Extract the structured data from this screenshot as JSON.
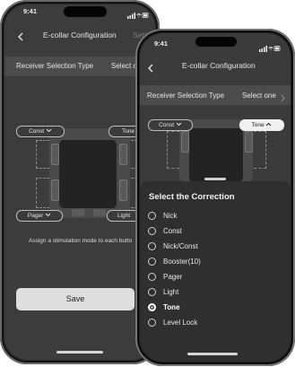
{
  "back_screen": {
    "status_time": "9:41",
    "nav_title": "E-collar Configuration",
    "nav_right": "Setti",
    "receiver_row": {
      "label": "Receiver Selection Type",
      "value": "Select o"
    },
    "chips": {
      "top_left": "Const",
      "top_right": "Tone",
      "bottom_left": "Pager",
      "bottom_right": "Light"
    },
    "help_text": "Assign a stimulation mode to each butto",
    "save_label": "Save"
  },
  "front_screen": {
    "status_time": "9:41",
    "back_icon": "chevron-left-icon",
    "nav_title": "E-collar Configuration",
    "receiver_row": {
      "label": "Receiver Selection Type",
      "value": "Select one"
    },
    "chips": {
      "left": "Const",
      "right": "Tone"
    },
    "sheet": {
      "title": "Select the Correction",
      "options": [
        {
          "label": "Nick",
          "selected": false
        },
        {
          "label": "Const",
          "selected": false
        },
        {
          "label": "Nick/Const",
          "selected": false
        },
        {
          "label": "Booster(10)",
          "selected": false
        },
        {
          "label": "Pager",
          "selected": false
        },
        {
          "label": "Light",
          "selected": false
        },
        {
          "label": "Tone",
          "selected": true
        },
        {
          "label": "Level Lock",
          "selected": false
        }
      ]
    }
  },
  "colors": {
    "screen_bg": "#3c3c3c",
    "sheet_bg": "#2f2f2f",
    "chip_active": "#f0f0f0"
  }
}
